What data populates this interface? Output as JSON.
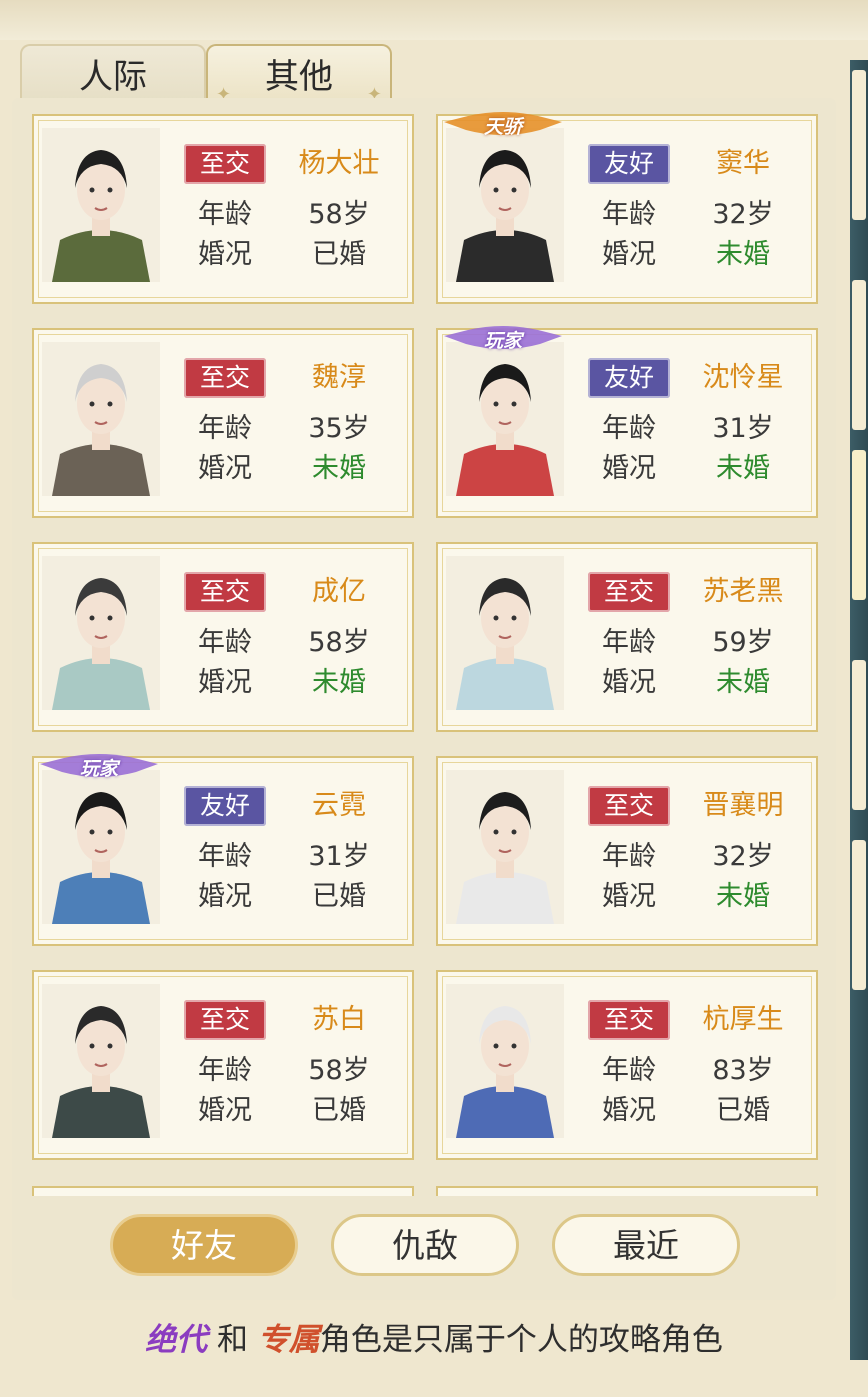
{
  "tabs": [
    {
      "label": "人际",
      "active": false
    },
    {
      "label": "其他",
      "active": true
    }
  ],
  "friends": [
    {
      "relation": "至交",
      "relation_color": "red",
      "name": "杨大壮",
      "age_label": "年龄",
      "age": "58岁",
      "marital_label": "婚况",
      "marital": "已婚",
      "marital_color": "dark",
      "tag": "",
      "portrait": "bearded-man-portrait"
    },
    {
      "relation": "友好",
      "relation_color": "purple",
      "name": "窦华",
      "age_label": "年龄",
      "age": "32岁",
      "marital_label": "婚况",
      "marital": "未婚",
      "marital_color": "green",
      "tag": "天骄",
      "portrait": "young-warrior-portrait"
    },
    {
      "relation": "至交",
      "relation_color": "red",
      "name": "魏淳",
      "age_label": "年龄",
      "age": "35岁",
      "marital_label": "婚况",
      "marital": "未婚",
      "marital_color": "green",
      "tag": "",
      "portrait": "monk-portrait"
    },
    {
      "relation": "友好",
      "relation_color": "purple",
      "name": "沈怜星",
      "age_label": "年龄",
      "age": "31岁",
      "marital_label": "婚况",
      "marital": "未婚",
      "marital_color": "green",
      "tag": "玩家",
      "portrait": "woman-red-robe-portrait"
    },
    {
      "relation": "至交",
      "relation_color": "red",
      "name": "成亿",
      "age_label": "年龄",
      "age": "58岁",
      "marital_label": "婚况",
      "marital": "未婚",
      "marital_color": "green",
      "tag": "",
      "portrait": "long-hair-man-portrait"
    },
    {
      "relation": "至交",
      "relation_color": "red",
      "name": "苏老黑",
      "age_label": "年龄",
      "age": "59岁",
      "marital_label": "婚况",
      "marital": "未婚",
      "marital_color": "green",
      "tag": "",
      "portrait": "official-hat-portrait"
    },
    {
      "relation": "友好",
      "relation_color": "purple",
      "name": "云霓",
      "age_label": "年龄",
      "age": "31岁",
      "marital_label": "婚况",
      "marital": "已婚",
      "marital_color": "dark",
      "tag": "玩家",
      "portrait": "woman-blue-robe-portrait"
    },
    {
      "relation": "至交",
      "relation_color": "red",
      "name": "晋襄明",
      "age_label": "年龄",
      "age": "32岁",
      "marital_label": "婚况",
      "marital": "未婚",
      "marital_color": "green",
      "tag": "",
      "portrait": "straw-hat-swordsman-portrait"
    },
    {
      "relation": "至交",
      "relation_color": "red",
      "name": "苏白",
      "age_label": "年龄",
      "age": "58岁",
      "marital_label": "婚况",
      "marital": "已婚",
      "marital_color": "dark",
      "tag": "",
      "portrait": "scholar-portrait"
    },
    {
      "relation": "至交",
      "relation_color": "red",
      "name": "杭厚生",
      "age_label": "年龄",
      "age": "83岁",
      "marital_label": "婚况",
      "marital": "已婚",
      "marital_color": "dark",
      "tag": "",
      "portrait": "white-hair-elder-portrait"
    }
  ],
  "filter_buttons": [
    {
      "label": "好友",
      "active": true
    },
    {
      "label": "仇敌",
      "active": false
    },
    {
      "label": "最近",
      "active": false
    }
  ],
  "footer": {
    "keyword1": "绝代",
    "connector": " 和 ",
    "keyword2": "专属",
    "text": "角色是只属于个人的攻略角色"
  },
  "colors": {
    "relation_red": "#c13a43",
    "relation_purple": "#5a55a2",
    "name_orange": "#d88a1a",
    "status_green": "#2e8b2e",
    "button_active": "#d7ac55"
  }
}
